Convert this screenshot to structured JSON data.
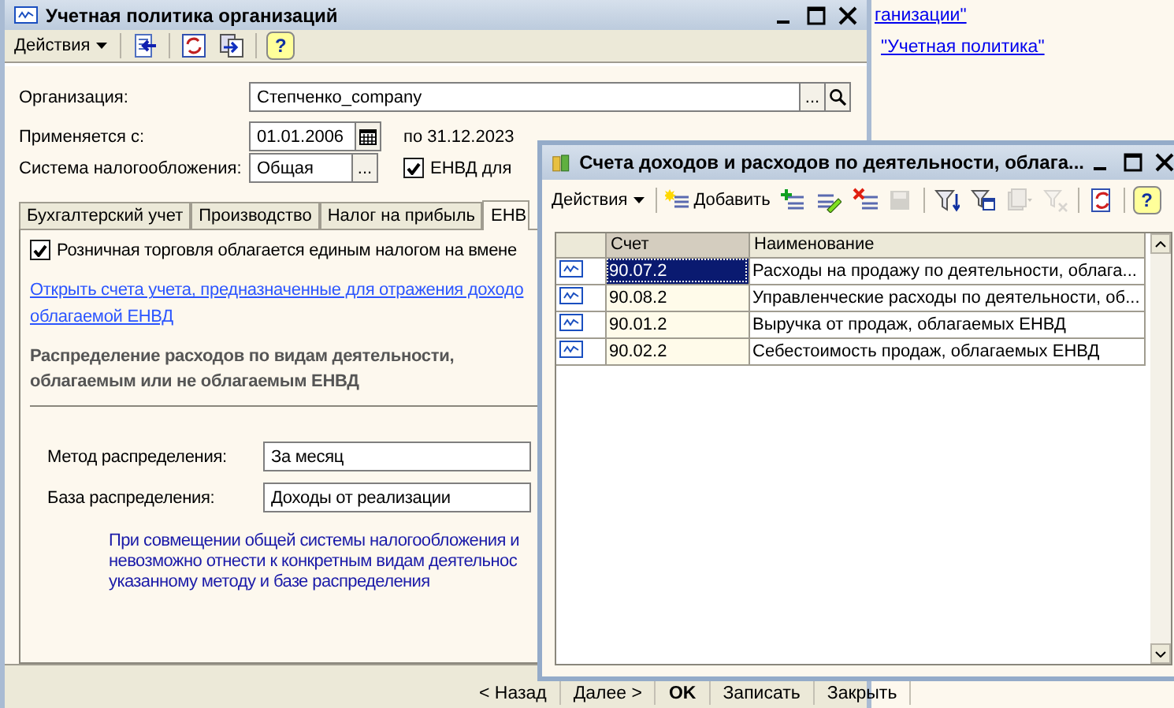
{
  "desktop": {
    "links": [
      "ганизации\"",
      "\"Учетная политика\""
    ]
  },
  "policy_window": {
    "title": "Учетная политика организаций",
    "toolbar": {
      "menu": "Действия",
      "help": "?"
    },
    "organization": {
      "label": "Организация:",
      "value": "Степченко_company",
      "choose": "..."
    },
    "applies_from": {
      "label": "Применяется с:",
      "value": "01.01.2006",
      "until": "по 31.12.2023"
    },
    "tax_system": {
      "label": "Система налогообложения:",
      "value": "Общая",
      "choose": "...",
      "envd": {
        "label": "ЕНВД для",
        "checked": true
      }
    },
    "tabs": [
      {
        "label": "Бухгалтерский учет",
        "selected": false
      },
      {
        "label": "Производство",
        "selected": false
      },
      {
        "label": "Налог на прибыль",
        "selected": false
      },
      {
        "label": "ЕНВ",
        "selected": true
      }
    ],
    "envd_tab": {
      "retail": {
        "label": "Розничная торговля облагается единым налогом на вмене",
        "checked": true
      },
      "link": [
        "Открыть счета учета, предназначенные для отражения  доходо",
        "облагаемой ЕНВД"
      ],
      "heading": [
        "Распределение расходов по видам деятельности,",
        "облагаемым или не облагаемым ЕНВД"
      ],
      "method": {
        "label": "Метод распределения:",
        "value": "За месяц"
      },
      "base": {
        "label": "База распределения:",
        "value": "Доходы от реализации"
      },
      "note": [
        "При совмещении общей системы налогообложения и",
        "невозможно отнести к конкретным видам деятельнос",
        "указанному методу и базе распределения"
      ]
    },
    "buttons": [
      {
        "label": "< Назад",
        "kind": "normal"
      },
      {
        "label": "Далее >",
        "kind": "normal"
      },
      {
        "label": "OK",
        "kind": "default"
      },
      {
        "label": "Записать",
        "kind": "normal"
      },
      {
        "label": "Закрыть",
        "kind": "normal"
      }
    ]
  },
  "accounts_window": {
    "title": "Счета доходов и расходов по деятельности, облага...",
    "toolbar": {
      "menu": "Действия",
      "add": "Добавить",
      "help": "?"
    },
    "columns": [
      "Счет",
      "Наименование"
    ],
    "rows": [
      {
        "account": "90.07.2",
        "name": "Расходы на продажу по деятельности, облага...",
        "selected": true
      },
      {
        "account": "90.08.2",
        "name": "Управленческие расходы по деятельности, об...",
        "selected": false
      },
      {
        "account": "90.01.2",
        "name": "Выручка от продаж, облагаемых ЕНВД",
        "selected": false
      },
      {
        "account": "90.02.2",
        "name": "Себестоимость продаж, облагаемых ЕНВД",
        "selected": false
      }
    ]
  }
}
